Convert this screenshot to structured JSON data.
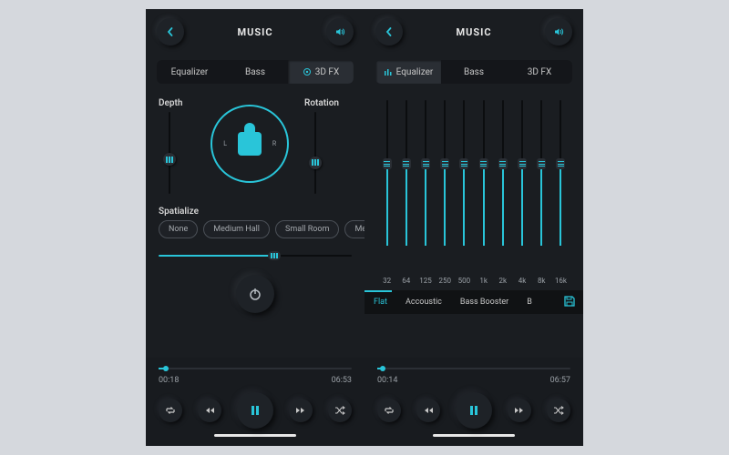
{
  "colors": {
    "accent": "#29c5d9",
    "bg": "#1a1d21"
  },
  "header": {
    "title": "MUSIC"
  },
  "tabs": {
    "equalizer": "Equalizer",
    "bass": "Bass",
    "fx3d": "3D FX"
  },
  "left": {
    "active_tab": "3D FX",
    "depth_label": "Depth",
    "rotation_label": "Rotation",
    "depth_value_pct": 42,
    "rotation_value_pct": 38,
    "circle": {
      "l": "L",
      "r": "R"
    },
    "spatialize_label": "Spatialize",
    "spatialize_options": [
      "None",
      "Medium Hall",
      "Small Room",
      "Med"
    ],
    "spatialize_slider_pct": 60,
    "player": {
      "elapsed": "00:18",
      "total": "06:53",
      "progress_pct": 4
    }
  },
  "right": {
    "active_tab": "Equalizer",
    "eq": {
      "bands": [
        {
          "freq": "32",
          "pct": 56
        },
        {
          "freq": "64",
          "pct": 56
        },
        {
          "freq": "125",
          "pct": 56
        },
        {
          "freq": "250",
          "pct": 56
        },
        {
          "freq": "500",
          "pct": 56
        },
        {
          "freq": "1k",
          "pct": 56
        },
        {
          "freq": "2k",
          "pct": 56
        },
        {
          "freq": "4k",
          "pct": 56
        },
        {
          "freq": "8k",
          "pct": 56
        },
        {
          "freq": "16k",
          "pct": 56
        }
      ]
    },
    "presets": [
      "Flat",
      "Accoustic",
      "Bass Booster",
      "B"
    ],
    "active_preset": "Flat",
    "player": {
      "elapsed": "00:14",
      "total": "06:57",
      "progress_pct": 3
    }
  }
}
